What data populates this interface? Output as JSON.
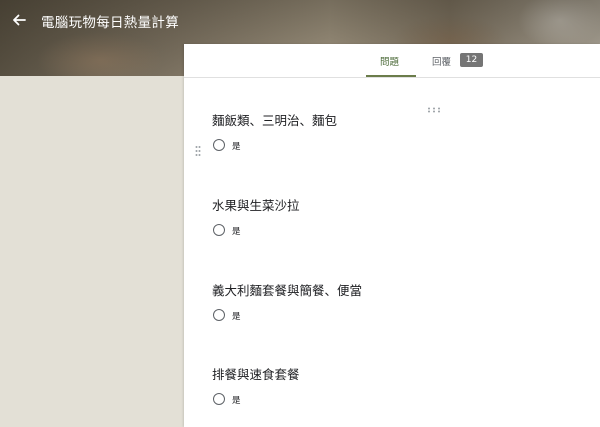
{
  "header": {
    "title": "電腦玩物每日熱量計算",
    "back_icon": "arrow-left-icon"
  },
  "tabs": [
    {
      "label": "問題",
      "active": true
    },
    {
      "label": "回覆",
      "count": "12",
      "active": false
    }
  ],
  "colors": {
    "accent": "#6b7c4a",
    "background": "#e3e0d6",
    "badge": "#757575"
  },
  "questions": [
    {
      "title": "麵飯類、三明治、麵包",
      "options": [
        {
          "label": "是"
        }
      ]
    },
    {
      "title": "水果與生菜沙拉",
      "options": [
        {
          "label": "是"
        }
      ]
    },
    {
      "title": "義大利麵套餐與簡餐、便當",
      "options": [
        {
          "label": "是"
        }
      ]
    },
    {
      "title": "排餐與速食套餐",
      "options": [
        {
          "label": "是"
        }
      ]
    }
  ]
}
